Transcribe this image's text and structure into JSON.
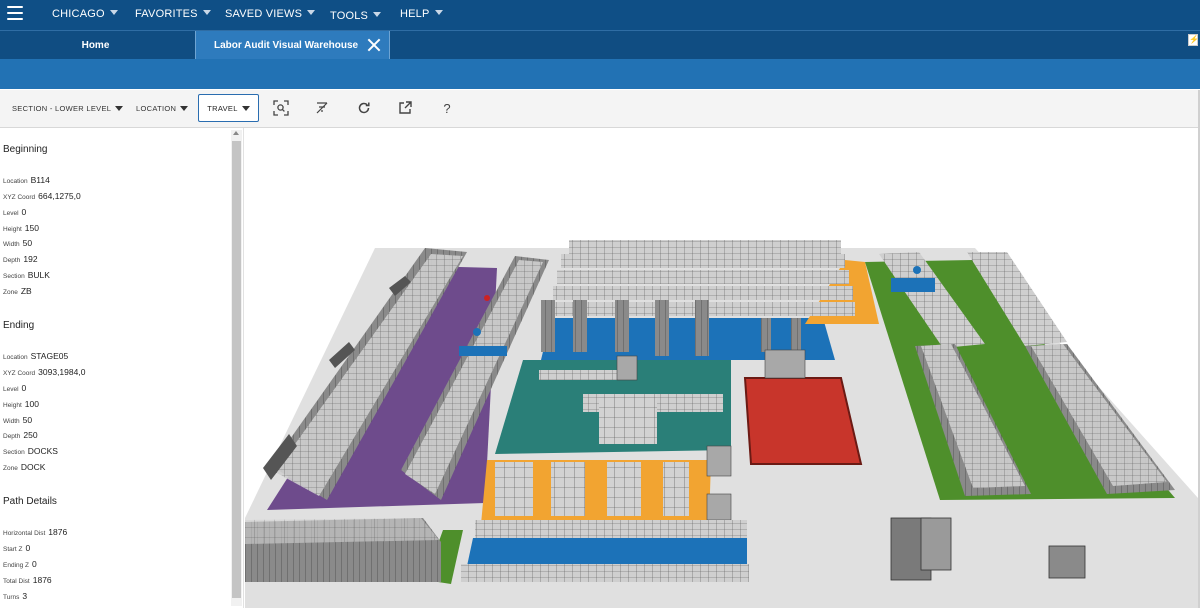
{
  "nav": {
    "menu": [
      {
        "label": "CHICAGO"
      },
      {
        "label": "FAVORITES"
      },
      {
        "label": "SAVED VIEWS"
      },
      {
        "label": "TOOLS"
      },
      {
        "label": "HELP"
      }
    ]
  },
  "tabs": {
    "home": "Home",
    "active": "Labor Audit Visual Warehouse"
  },
  "toolbar": {
    "section": "SECTION - LOWER LEVEL",
    "location": "LOCATION",
    "travel": "TRAVEL",
    "help": "?"
  },
  "panel": {
    "beginning": {
      "title": "Beginning",
      "fields": [
        {
          "label": "Location",
          "value": "B114"
        },
        {
          "label": "XYZ Coord",
          "value": "664,1275,0"
        },
        {
          "label": "Level",
          "value": "0"
        },
        {
          "label": "Height",
          "value": "150"
        },
        {
          "label": "Width",
          "value": "50"
        },
        {
          "label": "Depth",
          "value": "192"
        },
        {
          "label": "Section",
          "value": "BULK"
        },
        {
          "label": "Zone",
          "value": "ZB"
        }
      ]
    },
    "ending": {
      "title": "Ending",
      "fields": [
        {
          "label": "Location",
          "value": "STAGE05"
        },
        {
          "label": "XYZ Coord",
          "value": "3093,1984,0"
        },
        {
          "label": "Level",
          "value": "0"
        },
        {
          "label": "Height",
          "value": "100"
        },
        {
          "label": "Width",
          "value": "50"
        },
        {
          "label": "Depth",
          "value": "250"
        },
        {
          "label": "Section",
          "value": "DOCKS"
        },
        {
          "label": "Zone",
          "value": "DOCK"
        }
      ]
    },
    "path": {
      "title": "Path Details",
      "fields": [
        {
          "label": "Horizontal Dist",
          "value": "1876"
        },
        {
          "label": "Start Z",
          "value": "0"
        },
        {
          "label": "Ending Z",
          "value": "0"
        },
        {
          "label": "Total Dist",
          "value": "1876"
        },
        {
          "label": "Turns",
          "value": "3"
        }
      ]
    }
  },
  "colors": {
    "nav": "#0f4f86",
    "band": "#2272b4",
    "zone_purple": "#6e4b8c",
    "zone_orange": "#f2a431",
    "zone_blue": "#1c72b8",
    "zone_teal": "#2a7f78",
    "zone_red": "#c8352b",
    "zone_green": "#4e8f2b",
    "floor": "#e2e2e2",
    "rack": "#bdbdbd"
  }
}
